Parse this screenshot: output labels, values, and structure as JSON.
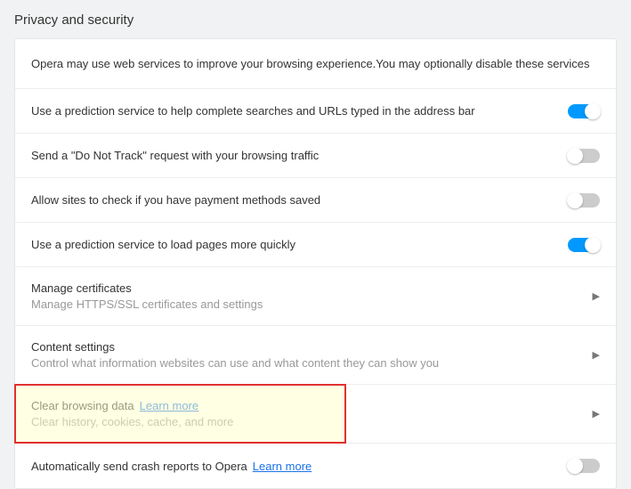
{
  "title": "Privacy and security",
  "intro": "Opera may use web services to improve your browsing experience.You may optionally disable these services",
  "rows": {
    "prediction_search": {
      "label": "Use a prediction service to help complete searches and URLs typed in the address bar",
      "on": true
    },
    "dnt": {
      "label": "Send a \"Do Not Track\" request with your browsing traffic",
      "on": false
    },
    "payment": {
      "label": "Allow sites to check if you have payment methods saved",
      "on": false
    },
    "prediction_load": {
      "label": "Use a prediction service to load pages more quickly",
      "on": true
    },
    "certificates": {
      "label": "Manage certificates",
      "sub": "Manage HTTPS/SSL certificates and settings"
    },
    "content": {
      "label": "Content settings",
      "sub": "Control what information websites can use and what content they can show you"
    },
    "clear": {
      "label": "Clear browsing data",
      "link": "Learn more",
      "sub": "Clear history, cookies, cache, and more"
    },
    "crash": {
      "label": "Automatically send crash reports to Opera",
      "link": "Learn more",
      "on": false
    }
  }
}
